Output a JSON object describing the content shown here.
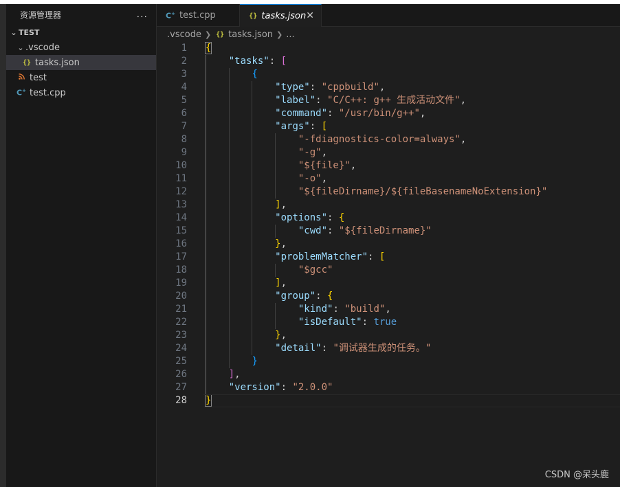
{
  "sidebar": {
    "title": "资源管理器",
    "more_icon": "...",
    "section": "TEST",
    "items": [
      {
        "label": ".vscode",
        "icon": "chevron-down-icon"
      },
      {
        "label": "tasks.json",
        "icon": "json-icon",
        "icon_glyph": "{}"
      },
      {
        "label": "test",
        "icon": "rss-icon",
        "icon_glyph": "ʼn"
      },
      {
        "label": "test.cpp",
        "icon": "cpp-icon",
        "icon_glyph": "C+"
      }
    ]
  },
  "tabs": [
    {
      "label": "test.cpp",
      "icon_glyph": "C+",
      "active": false
    },
    {
      "label": "tasks.json",
      "icon_glyph": "{}",
      "active": true,
      "close": "✕"
    }
  ],
  "breadcrumb": {
    "folder": ".vscode",
    "file_icon": "{}",
    "file": "tasks.json",
    "more": "..."
  },
  "editor": {
    "active_line": 28,
    "lines": [
      {
        "n": 1,
        "tokens": [
          [
            "b1",
            "{"
          ]
        ]
      },
      {
        "n": 2,
        "tokens": [
          [
            "p",
            "    "
          ],
          [
            "k",
            "\"tasks\""
          ],
          [
            "p",
            ": "
          ],
          [
            "b2",
            "["
          ]
        ]
      },
      {
        "n": 3,
        "tokens": [
          [
            "p",
            "        "
          ],
          [
            "b3",
            "{"
          ]
        ]
      },
      {
        "n": 4,
        "tokens": [
          [
            "p",
            "            "
          ],
          [
            "k",
            "\"type\""
          ],
          [
            "p",
            ": "
          ],
          [
            "s",
            "\"cppbuild\""
          ],
          [
            "p",
            ","
          ]
        ]
      },
      {
        "n": 5,
        "tokens": [
          [
            "p",
            "            "
          ],
          [
            "k",
            "\"label\""
          ],
          [
            "p",
            ": "
          ],
          [
            "s",
            "\"C/C++: g++ 生成活动文件\""
          ],
          [
            "p",
            ","
          ]
        ]
      },
      {
        "n": 6,
        "tokens": [
          [
            "p",
            "            "
          ],
          [
            "k",
            "\"command\""
          ],
          [
            "p",
            ": "
          ],
          [
            "s",
            "\"/usr/bin/g++\""
          ],
          [
            "p",
            ","
          ]
        ]
      },
      {
        "n": 7,
        "tokens": [
          [
            "p",
            "            "
          ],
          [
            "k",
            "\"args\""
          ],
          [
            "p",
            ": "
          ],
          [
            "b1",
            "["
          ]
        ]
      },
      {
        "n": 8,
        "tokens": [
          [
            "p",
            "                "
          ],
          [
            "s",
            "\"-fdiagnostics-color=always\""
          ],
          [
            "p",
            ","
          ]
        ]
      },
      {
        "n": 9,
        "tokens": [
          [
            "p",
            "                "
          ],
          [
            "s",
            "\"-g\""
          ],
          [
            "p",
            ","
          ]
        ]
      },
      {
        "n": 10,
        "tokens": [
          [
            "p",
            "                "
          ],
          [
            "s",
            "\"${file}\""
          ],
          [
            "p",
            ","
          ]
        ]
      },
      {
        "n": 11,
        "tokens": [
          [
            "p",
            "                "
          ],
          [
            "s",
            "\"-o\""
          ],
          [
            "p",
            ","
          ]
        ]
      },
      {
        "n": 12,
        "tokens": [
          [
            "p",
            "                "
          ],
          [
            "s",
            "\"${fileDirname}/${fileBasenameNoExtension}\""
          ]
        ]
      },
      {
        "n": 13,
        "tokens": [
          [
            "p",
            "            "
          ],
          [
            "b1",
            "]"
          ],
          [
            "p",
            ","
          ]
        ]
      },
      {
        "n": 14,
        "tokens": [
          [
            "p",
            "            "
          ],
          [
            "k",
            "\"options\""
          ],
          [
            "p",
            ": "
          ],
          [
            "b1",
            "{"
          ]
        ]
      },
      {
        "n": 15,
        "tokens": [
          [
            "p",
            "                "
          ],
          [
            "k",
            "\"cwd\""
          ],
          [
            "p",
            ": "
          ],
          [
            "s",
            "\"${fileDirname}\""
          ]
        ]
      },
      {
        "n": 16,
        "tokens": [
          [
            "p",
            "            "
          ],
          [
            "b1",
            "}"
          ],
          [
            "p",
            ","
          ]
        ]
      },
      {
        "n": 17,
        "tokens": [
          [
            "p",
            "            "
          ],
          [
            "k",
            "\"problemMatcher\""
          ],
          [
            "p",
            ": "
          ],
          [
            "b1",
            "["
          ]
        ]
      },
      {
        "n": 18,
        "tokens": [
          [
            "p",
            "                "
          ],
          [
            "s",
            "\"$gcc\""
          ]
        ]
      },
      {
        "n": 19,
        "tokens": [
          [
            "p",
            "            "
          ],
          [
            "b1",
            "]"
          ],
          [
            "p",
            ","
          ]
        ]
      },
      {
        "n": 20,
        "tokens": [
          [
            "p",
            "            "
          ],
          [
            "k",
            "\"group\""
          ],
          [
            "p",
            ": "
          ],
          [
            "b1",
            "{"
          ]
        ]
      },
      {
        "n": 21,
        "tokens": [
          [
            "p",
            "                "
          ],
          [
            "k",
            "\"kind\""
          ],
          [
            "p",
            ": "
          ],
          [
            "s",
            "\"build\""
          ],
          [
            "p",
            ","
          ]
        ]
      },
      {
        "n": 22,
        "tokens": [
          [
            "p",
            "                "
          ],
          [
            "k",
            "\"isDefault\""
          ],
          [
            "p",
            ": "
          ],
          [
            "bool",
            "true"
          ]
        ]
      },
      {
        "n": 23,
        "tokens": [
          [
            "p",
            "            "
          ],
          [
            "b1",
            "}"
          ],
          [
            "p",
            ","
          ]
        ]
      },
      {
        "n": 24,
        "tokens": [
          [
            "p",
            "            "
          ],
          [
            "k",
            "\"detail\""
          ],
          [
            "p",
            ": "
          ],
          [
            "s",
            "\"调试器生成的任务。\""
          ]
        ]
      },
      {
        "n": 25,
        "tokens": [
          [
            "p",
            "        "
          ],
          [
            "b3",
            "}"
          ]
        ]
      },
      {
        "n": 26,
        "tokens": [
          [
            "p",
            "    "
          ],
          [
            "b2",
            "]"
          ],
          [
            "p",
            ","
          ]
        ]
      },
      {
        "n": 27,
        "tokens": [
          [
            "p",
            "    "
          ],
          [
            "k",
            "\"version\""
          ],
          [
            "p",
            ": "
          ],
          [
            "s",
            "\"2.0.0\""
          ]
        ]
      },
      {
        "n": 28,
        "tokens": [
          [
            "b1",
            "}"
          ]
        ]
      }
    ]
  },
  "watermark": "CSDN @呆头鹿"
}
